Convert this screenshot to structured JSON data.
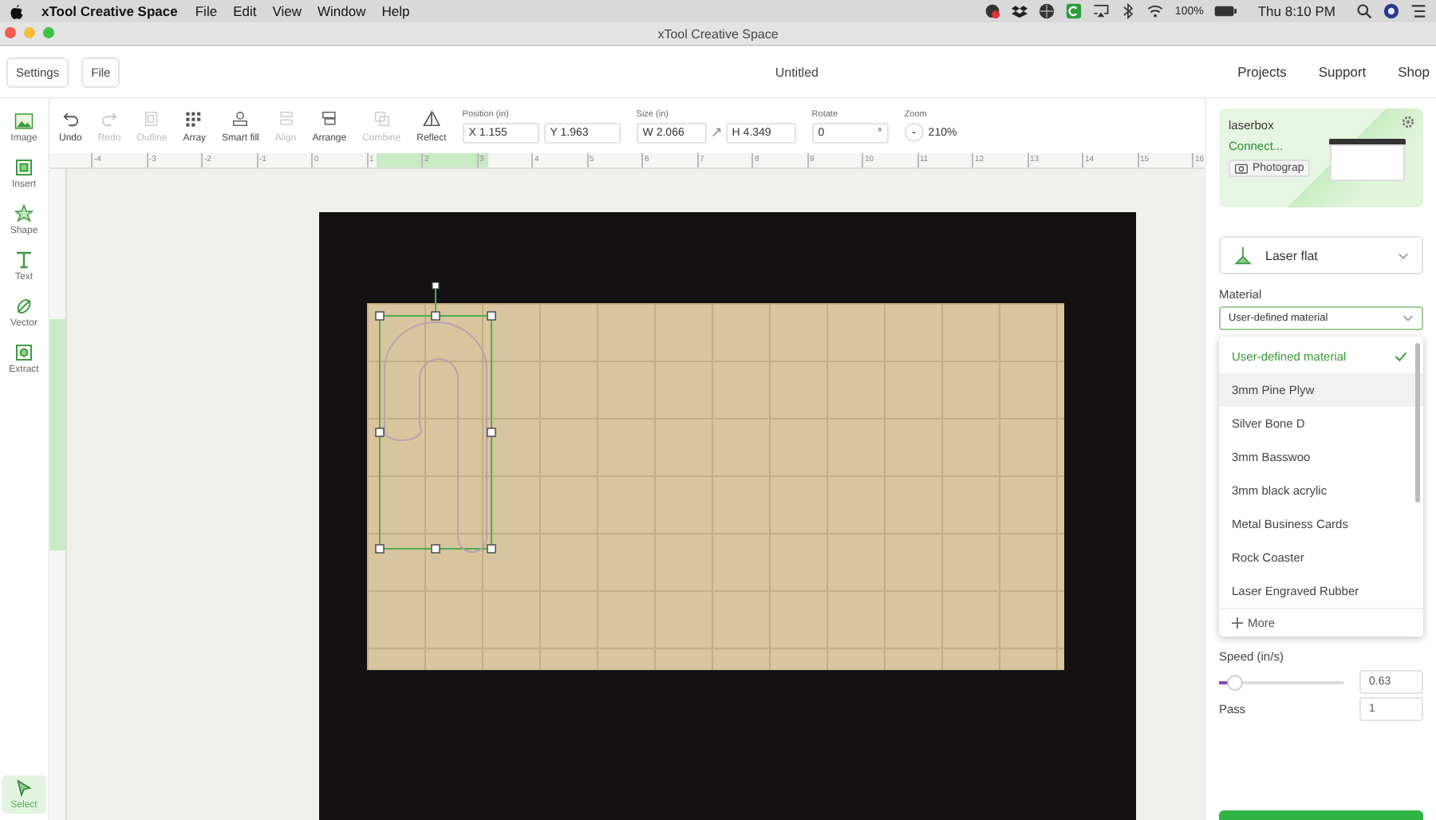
{
  "menubar": {
    "app": "xTool Creative Space",
    "menus": [
      "File",
      "Edit",
      "View",
      "Window",
      "Help"
    ],
    "battery": "100%",
    "clock": "Thu 8:10 PM"
  },
  "window": {
    "title": "xTool Creative Space"
  },
  "header": {
    "buttons": [
      "Settings",
      "File"
    ],
    "document": "Untitled",
    "links": [
      "Projects",
      "Support",
      "Shop"
    ]
  },
  "toolbar": {
    "tools": [
      {
        "label": "Undo",
        "disabled": false
      },
      {
        "label": "Redo",
        "disabled": true
      },
      {
        "label": "Outline",
        "disabled": true
      },
      {
        "label": "Array",
        "disabled": false
      },
      {
        "label": "Smart fill",
        "disabled": false
      },
      {
        "label": "Align",
        "disabled": true
      },
      {
        "label": "Arrange",
        "disabled": false
      },
      {
        "label": "Combine",
        "disabled": true
      },
      {
        "label": "Reflect",
        "disabled": false
      }
    ],
    "position": {
      "label": "Position (in)",
      "x": "X 1.155",
      "y": "Y 1.963"
    },
    "size": {
      "label": "Size (in)",
      "w": "W 2.066",
      "h": "H 4.349"
    },
    "rotate": {
      "label": "Rotate",
      "value": "0",
      "unit": "°"
    },
    "zoom": {
      "label": "Zoom",
      "minus": "-",
      "value": "210%"
    }
  },
  "sidebar": {
    "tools": [
      {
        "label": "Image",
        "selected": false
      },
      {
        "label": "Insert",
        "selected": false
      },
      {
        "label": "Shape",
        "selected": false
      },
      {
        "label": "Text",
        "selected": false
      },
      {
        "label": "Vector",
        "selected": false
      },
      {
        "label": "Extract",
        "selected": false
      }
    ],
    "bottom_tools": [
      {
        "label": "Select",
        "selected": true
      }
    ]
  },
  "ruler": {
    "labels": [
      "-4",
      "-3",
      "-2",
      "-1",
      "0",
      "1",
      "2",
      "3",
      "4",
      "5",
      "6",
      "7",
      "8",
      "9",
      "10",
      "11",
      "12",
      "13",
      "14",
      "15",
      "16"
    ]
  },
  "device": {
    "name": "laserbox",
    "status": "Connect...",
    "photo_button": "Photograp"
  },
  "mode": {
    "label": "Laser flat"
  },
  "material": {
    "label": "Material",
    "value": "User-defined material",
    "options": [
      {
        "label": "User-defined material",
        "selected": true
      },
      {
        "label": "3mm Pine Plyw",
        "selected": false
      },
      {
        "label": "Silver Bone D",
        "selected": false
      },
      {
        "label": "3mm Basswoo",
        "selected": false
      },
      {
        "label": "3mm black acrylic",
        "selected": false
      },
      {
        "label": "Metal Business Cards",
        "selected": false
      },
      {
        "label": "Rock Coaster",
        "selected": false
      },
      {
        "label": "Laser Engraved Rubber",
        "selected": false
      }
    ],
    "more": "More"
  },
  "speed": {
    "label": "Speed (in/s)",
    "level": 0.08,
    "value": "0.63"
  },
  "pass": {
    "label": "Pass",
    "value": "1"
  }
}
